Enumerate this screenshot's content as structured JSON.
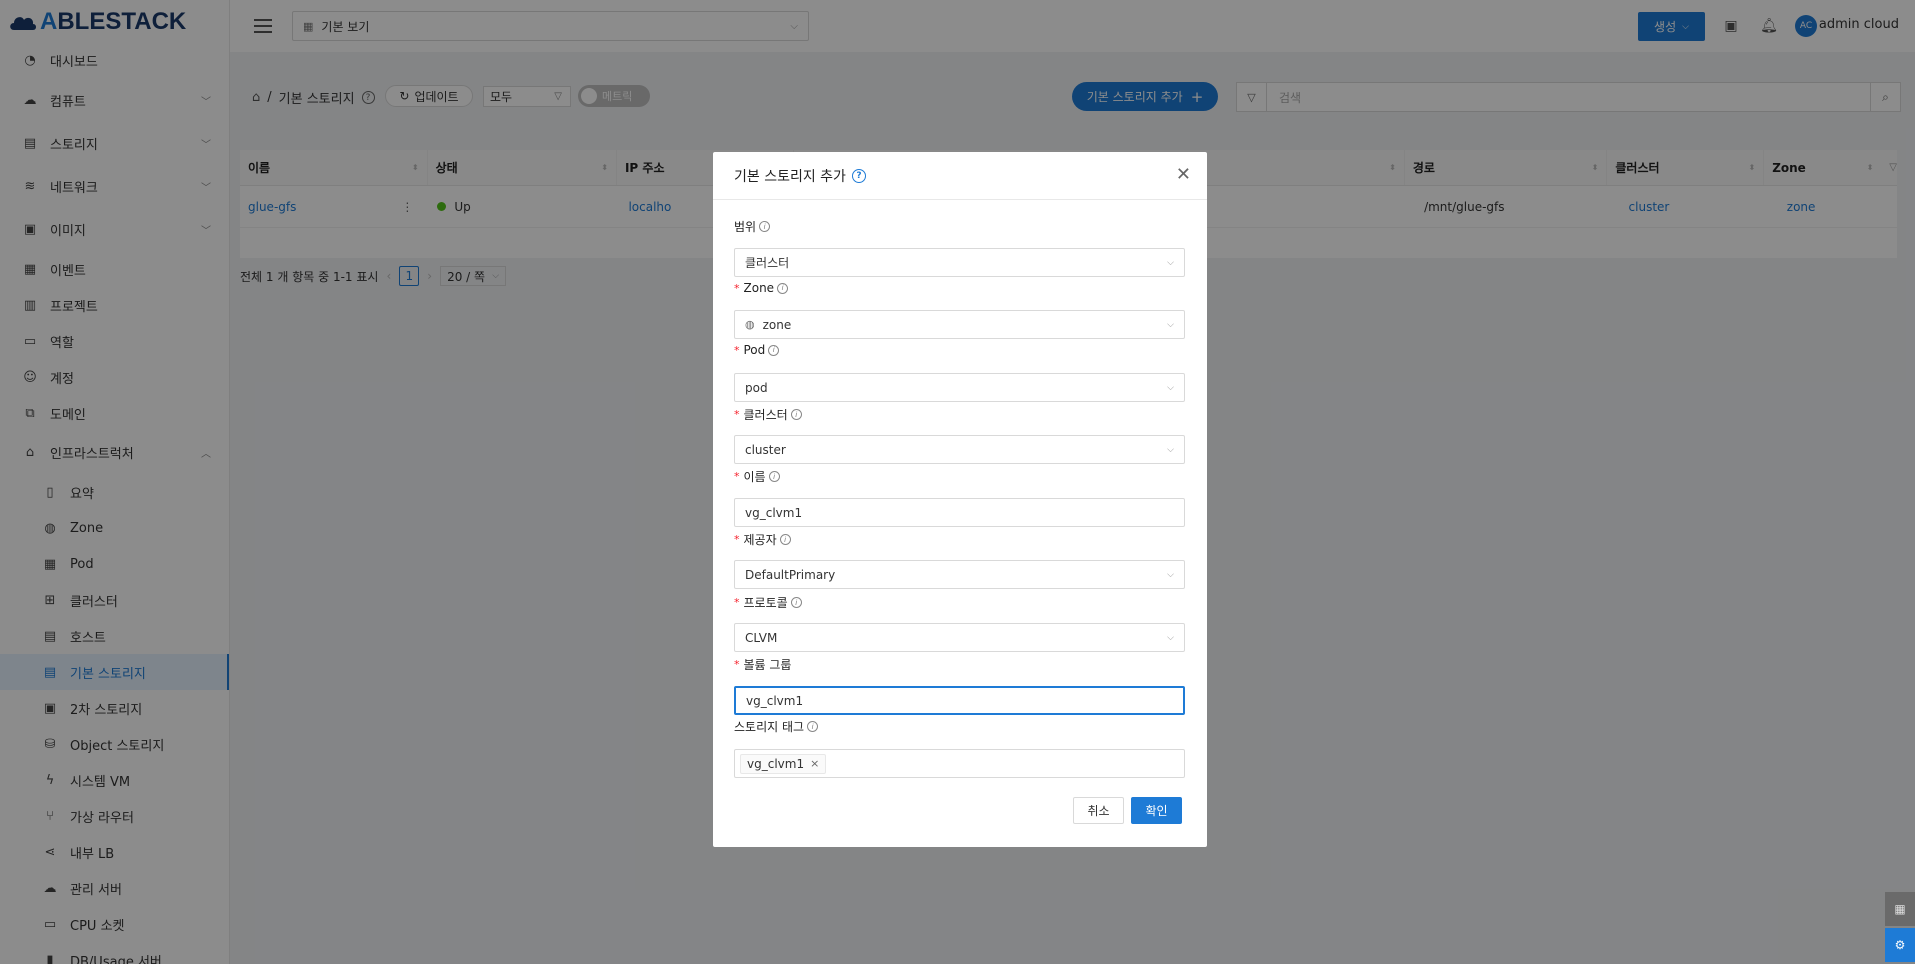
{
  "brand": {
    "logo_text_a": "A",
    "logo_text_b": "BLESTACK"
  },
  "sidebar": {
    "items": [
      {
        "label": "대시보드",
        "icon": "dashboard-icon",
        "glyph": "◔",
        "expandable": false
      },
      {
        "label": "컴퓨트",
        "icon": "cloud-icon",
        "glyph": "☁",
        "expandable": true
      },
      {
        "label": "스토리지",
        "icon": "database-icon",
        "glyph": "▤",
        "expandable": true
      },
      {
        "label": "네트워크",
        "icon": "wifi-icon",
        "glyph": "≋",
        "expandable": true
      },
      {
        "label": "이미지",
        "icon": "picture-icon",
        "glyph": "▣",
        "expandable": true
      },
      {
        "label": "이벤트",
        "icon": "calendar-icon",
        "glyph": "▦",
        "expandable": false
      },
      {
        "label": "프로젝트",
        "icon": "project-icon",
        "glyph": "▥",
        "expandable": false
      },
      {
        "label": "역할",
        "icon": "idcard-icon",
        "glyph": "▭",
        "expandable": false
      },
      {
        "label": "계정",
        "icon": "team-icon",
        "glyph": "☺",
        "expandable": false
      },
      {
        "label": "도메인",
        "icon": "block-icon",
        "glyph": "⧉",
        "expandable": false
      },
      {
        "label": "인프라스트럭처",
        "icon": "bank-icon",
        "glyph": "⌂",
        "expandable": true,
        "expanded": true
      }
    ],
    "sub_items": [
      {
        "label": "요약",
        "icon": "read-icon",
        "glyph": "▯"
      },
      {
        "label": "Zone",
        "icon": "globe-icon",
        "glyph": "◍"
      },
      {
        "label": "Pod",
        "icon": "appstore-icon",
        "glyph": "▦"
      },
      {
        "label": "클러스터",
        "icon": "cluster-icon",
        "glyph": "⊞"
      },
      {
        "label": "호스트",
        "icon": "host-icon",
        "glyph": "▤"
      },
      {
        "label": "기본 스토리지",
        "icon": "database-icon",
        "glyph": "▤",
        "active": true
      },
      {
        "label": "2차 스토리지",
        "icon": "picture-icon",
        "glyph": "▣"
      },
      {
        "label": "Object 스토리지",
        "icon": "gold-icon",
        "glyph": "⛁"
      },
      {
        "label": "시스템 VM",
        "icon": "thunderbolt-icon",
        "glyph": "ϟ"
      },
      {
        "label": "가상 라우터",
        "icon": "fork-icon",
        "glyph": "⑂"
      },
      {
        "label": "내부 LB",
        "icon": "share-icon",
        "glyph": "⋖"
      },
      {
        "label": "관리 서버",
        "icon": "cloud-server-icon",
        "glyph": "☁"
      },
      {
        "label": "CPU 소켓",
        "icon": "inbox-icon",
        "glyph": "▭"
      },
      {
        "label": "DB/Usage 서버",
        "icon": "bar-chart-icon",
        "glyph": "▮"
      }
    ]
  },
  "header": {
    "view_select": "기본 보기",
    "create_label": "생성",
    "avatar_initials": "AC",
    "user_name": "admin cloud"
  },
  "toolbar": {
    "breadcrumb_current": "기본 스토리지",
    "update_label": "업데이트",
    "filter_value": "모두",
    "toggle_label": "메트릭",
    "add_button": "기본 스토리지 추가",
    "search_placeholder": "검색"
  },
  "table": {
    "columns": [
      "이름",
      "상태",
      "IP 주소",
      "",
      "경로",
      "클러스터",
      "Zone"
    ],
    "rows": [
      {
        "name": "glue-gfs",
        "state": "Up",
        "ip": "localho",
        "path": "/mnt/glue-gfs",
        "cluster": "cluster",
        "zone": "zone"
      }
    ],
    "pagination": {
      "summary": "전체 1 개 항목 중 1-1 표시",
      "page": "1",
      "page_size": "20 / 쪽"
    }
  },
  "modal": {
    "title": "기본 스토리지 추가",
    "fields": [
      {
        "label": "범위",
        "required": false,
        "value": "클러스터",
        "type": "select"
      },
      {
        "label": "Zone",
        "required": true,
        "value": "zone",
        "type": "select"
      },
      {
        "label": "Pod",
        "required": true,
        "value": "pod",
        "type": "select"
      },
      {
        "label": "클러스터",
        "required": true,
        "value": "cluster",
        "type": "select"
      },
      {
        "label": "이름",
        "required": true,
        "value": "vg_clvm1",
        "type": "input"
      },
      {
        "label": "제공자",
        "required": true,
        "value": "DefaultPrimary",
        "type": "select"
      },
      {
        "label": "프로토콜",
        "required": true,
        "value": "CLVM",
        "type": "select"
      },
      {
        "label": "볼륨 그룹",
        "required": true,
        "value": "vg_clvm1",
        "type": "input"
      },
      {
        "label": "스토리지 태그",
        "required": false,
        "value": "vg_clvm1",
        "type": "tags"
      }
    ],
    "cancel_label": "취소",
    "ok_label": "확인"
  },
  "colors": {
    "primary": "#1e7bd6",
    "success": "#52c41a",
    "required": "#f5222d"
  }
}
